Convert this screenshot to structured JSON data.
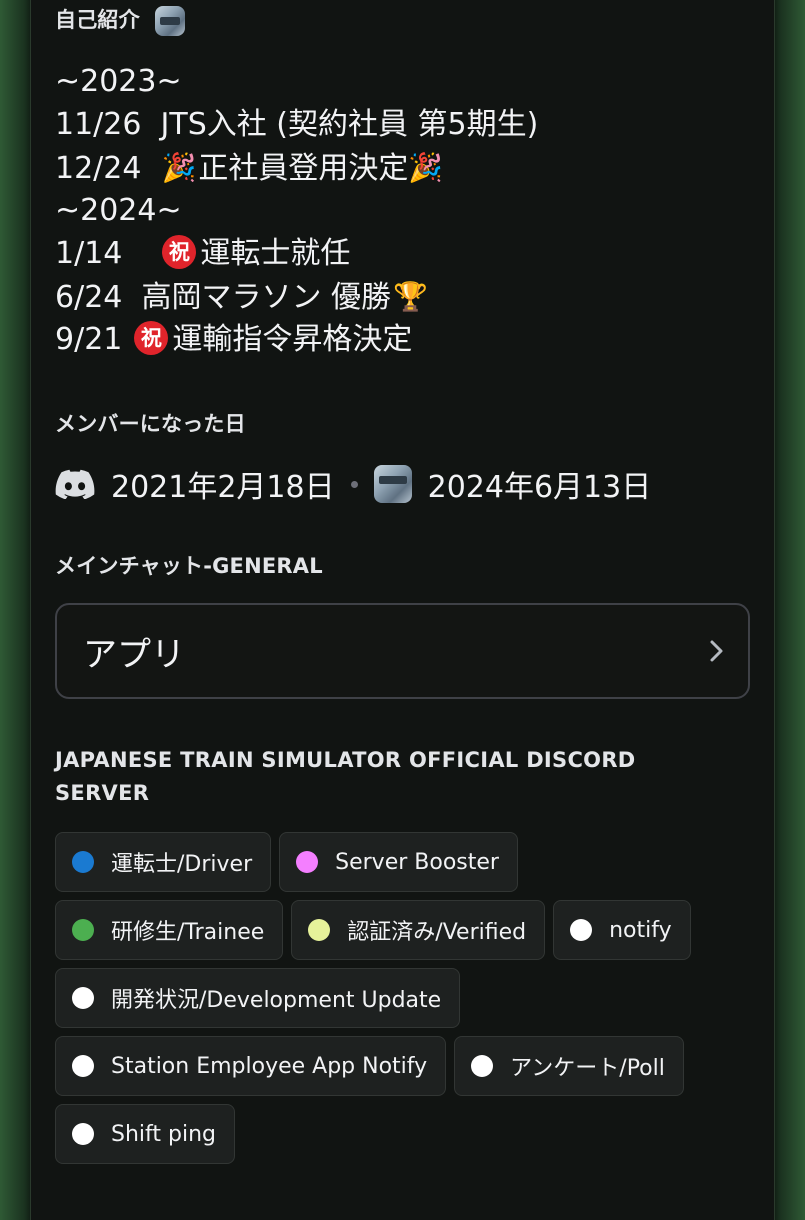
{
  "bio": {
    "title": "自己紹介",
    "lines": [
      "~2023~",
      "11/26  JTS入社 (契約社員 第5期生)",
      "12/24",
      "正社員登用決定",
      "~2024~",
      "1/14",
      "運転士就任",
      "6/24  高岡マラソン 優勝",
      "9/21",
      "運輸指令昇格決定"
    ],
    "iwai_glyph": "祝"
  },
  "member_since": {
    "title": "メンバーになった日",
    "discord_date": "2021年2月18日",
    "server_date": "2024年6月13日"
  },
  "channel": {
    "title": "メインチャット-GENERAL",
    "app_label": "アプリ"
  },
  "server": {
    "title": "JAPANESE TRAIN SIMULATOR OFFICIAL DISCORD SERVER",
    "roles": [
      {
        "label": "運転士/Driver",
        "color": "#1a7ad1"
      },
      {
        "label": "Server Booster",
        "color": "#f47fff"
      },
      {
        "label": "研修生/Trainee",
        "color": "#4caf50"
      },
      {
        "label": "認証済み/Verified",
        "color": "#e6f29a"
      },
      {
        "label": "notify",
        "color": "#ffffff"
      },
      {
        "label": "開発状況/Development Update",
        "color": "#ffffff"
      },
      {
        "label": "Station Employee App Notify",
        "color": "#ffffff"
      },
      {
        "label": "アンケート/Poll",
        "color": "#ffffff"
      },
      {
        "label": "Shift ping",
        "color": "#ffffff"
      }
    ]
  },
  "icons": {
    "discord": "discord-logo-icon",
    "server": "server-avatar-icon",
    "chevron": "chevron-right-icon",
    "party": "party-popper-icon",
    "trophy": "trophy-icon",
    "iwai": "iwai-badge-icon"
  }
}
